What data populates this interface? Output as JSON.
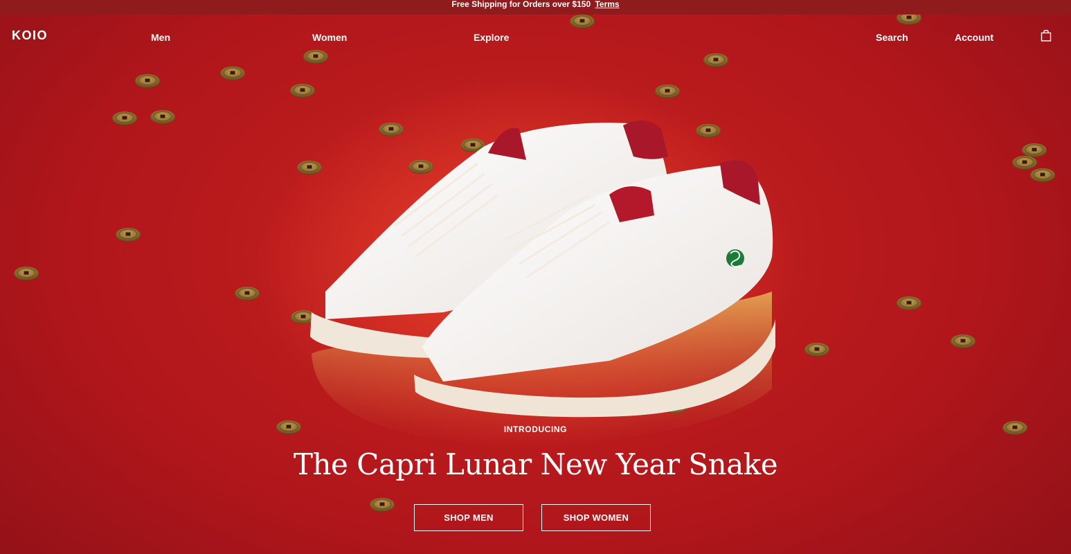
{
  "announcement": {
    "text": "Free Shipping for Orders over $150",
    "link_label": "Terms"
  },
  "header": {
    "logo": "KOIO",
    "nav_left": [
      {
        "label": "Men"
      },
      {
        "label": "Women"
      },
      {
        "label": "Explore"
      }
    ],
    "nav_right": [
      {
        "label": "Search"
      },
      {
        "label": "Account"
      }
    ],
    "cart_icon": "shopping-bag-icon"
  },
  "hero": {
    "eyebrow": "INTRODUCING",
    "title": "The Capri Lunar New Year Snake",
    "buttons": [
      {
        "label": "SHOP MEN"
      },
      {
        "label": "SHOP WOMEN"
      }
    ],
    "image_subject": "white leather sneakers with red heel tab and green snake emblem on red background with scattered gold coins"
  },
  "colors": {
    "announcement_bg": "#8f1b1d",
    "hero_bg": "#c9221f",
    "text": "#ffffff"
  }
}
